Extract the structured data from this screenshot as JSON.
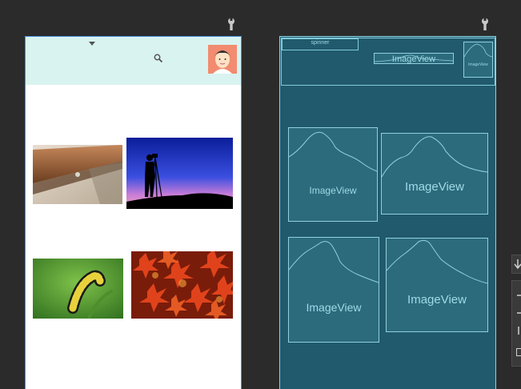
{
  "blueprint": {
    "spinner_label": "spinner",
    "imageview_label": "ImageView"
  },
  "icons": {
    "wrench": "wrench-icon",
    "dropdown": "caret-down-icon",
    "search": "search-icon",
    "avatar": "avatar-icon",
    "image_placeholder": "mountain-icon"
  },
  "colors": {
    "canvas_bg": "#2b2b2b",
    "toolbar_bg": "#d9f3f0",
    "frame_border": "#4a90d9",
    "blueprint_bg": "#215a6c",
    "blueprint_line": "#8fd0df"
  }
}
